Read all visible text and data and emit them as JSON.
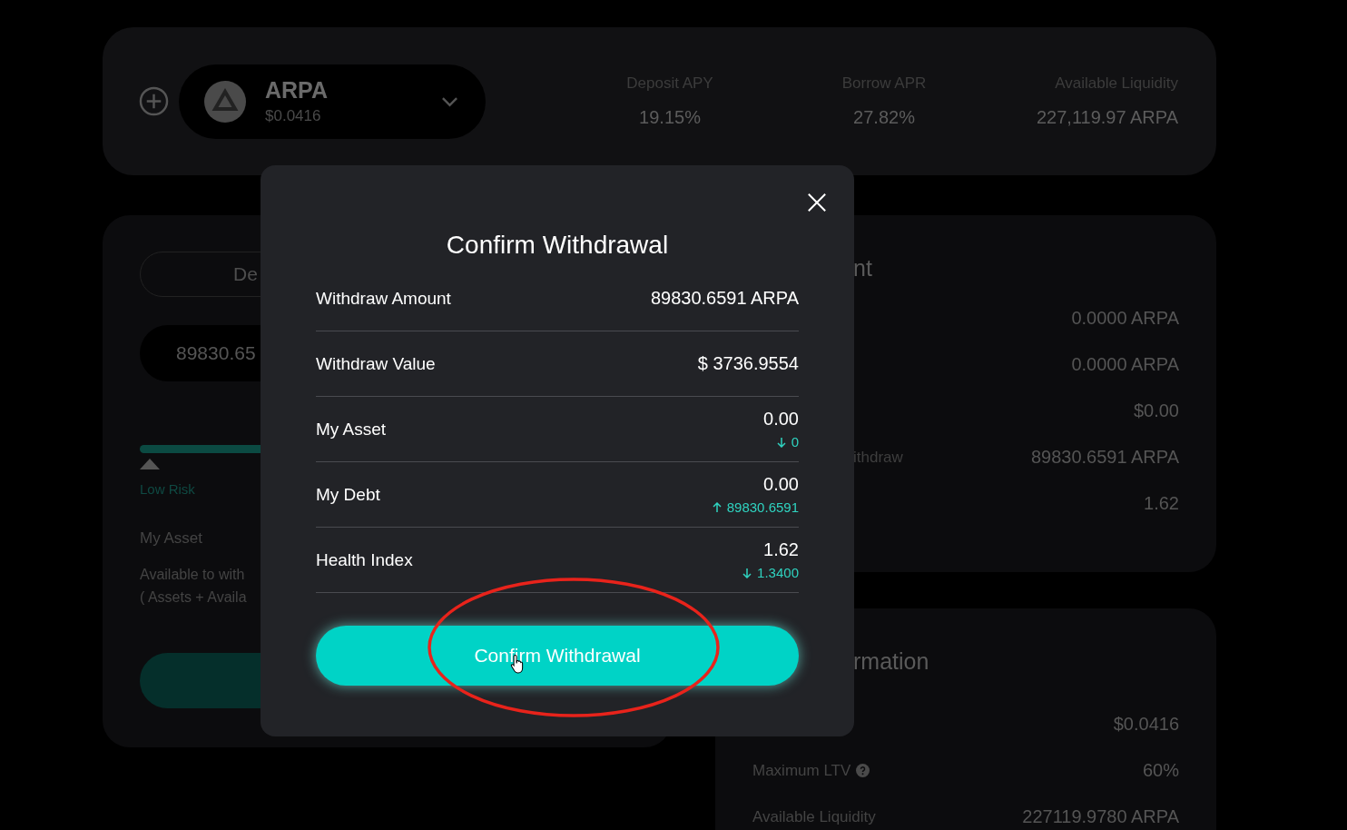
{
  "market_bar": {
    "token": {
      "symbol": "ARPA",
      "price": "$0.0416"
    },
    "stats": [
      {
        "label": "Deposit APY",
        "value": "19.15%"
      },
      {
        "label": "Borrow APR",
        "value": "27.82%"
      },
      {
        "label": "Available Liquidity",
        "value": "227,119.97 ARPA"
      }
    ]
  },
  "action_panel": {
    "tab": "De",
    "amount": "89830.65",
    "risk_label": "Low Risk",
    "lines": [
      "My Asset",
      "Available to with",
      "( Assets + Availa"
    ]
  },
  "summary_panel": {
    "heading": "nt",
    "rows": [
      {
        "value": "0.0000 ARPA"
      },
      {
        "value": "0.0000 ARPA"
      },
      {
        "value": "$0.00"
      },
      {
        "label": "ithdraw",
        "value": "89830.6591 ARPA"
      },
      {
        "value": "1.62"
      }
    ]
  },
  "info_panel": {
    "heading": "rmation",
    "rows": [
      {
        "value": "$0.0416"
      },
      {
        "label": "Maximum LTV",
        "help": true,
        "value": "60%"
      },
      {
        "label": "Available Liquidity",
        "value": "227119.9780 ARPA"
      }
    ]
  },
  "dialog": {
    "title": "Confirm Withdrawal",
    "rows": [
      {
        "label": "Withdraw Amount",
        "value": "89830.6591 ARPA"
      },
      {
        "label": "Withdraw Value",
        "value": "$ 3736.9554"
      },
      {
        "label": "My Asset",
        "value": "0.00",
        "change": {
          "kind": "down",
          "value": "0"
        }
      },
      {
        "label": "My Debt",
        "value": "0.00",
        "change": {
          "kind": "up",
          "value": "89830.6591"
        }
      },
      {
        "label": "Health Index",
        "value": "1.62",
        "change": {
          "kind": "down",
          "value": "1.3400"
        }
      }
    ],
    "confirm_button": "Confirm Withdrawal"
  }
}
